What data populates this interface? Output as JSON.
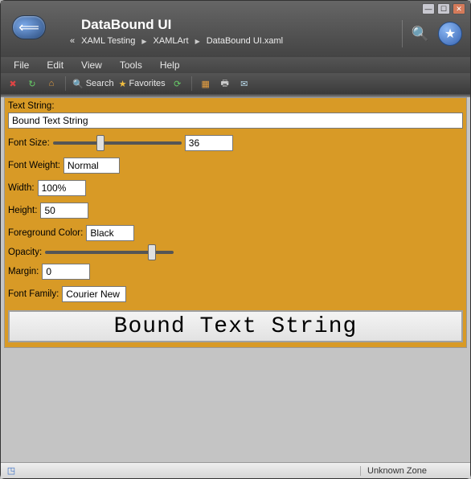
{
  "window": {
    "title": "DataBound UI"
  },
  "breadcrumb": {
    "prefix": "«",
    "items": [
      "XAML Testing",
      "XAMLArt",
      "DataBound UI.xaml"
    ]
  },
  "menu": {
    "items": [
      "File",
      "Edit",
      "View",
      "Tools",
      "Help"
    ]
  },
  "toolbar": {
    "search_label": "Search",
    "favorites_label": "Favorites"
  },
  "form": {
    "text_string_label": "Text String:",
    "text_string_value": "Bound Text String",
    "font_size_label": "Font Size:",
    "font_size_value": "36",
    "font_weight_label": "Font Weight:",
    "font_weight_value": "Normal",
    "width_label": "Width:",
    "width_value": "100%",
    "height_label": "Height:",
    "height_value": "50",
    "fg_color_label": "Foreground Color:",
    "fg_color_value": "Black",
    "opacity_label": "Opacity:",
    "margin_label": "Margin:",
    "margin_value": "0",
    "font_family_label": "Font Family:",
    "font_family_value": "Courier New"
  },
  "preview_text": "Bound Text String",
  "status": {
    "zone": "Unknown Zone"
  }
}
